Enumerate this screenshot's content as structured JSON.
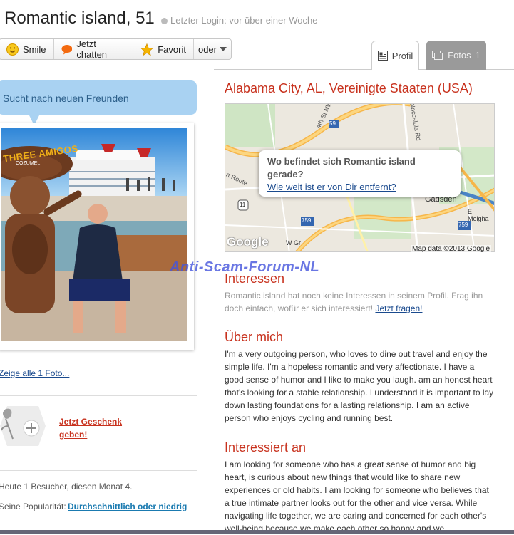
{
  "header": {
    "title": "Romantic island, 51",
    "status": "Letzter Login: vor über einer Woche"
  },
  "actions": {
    "smile": "Smile",
    "chat": "Jetzt chatten",
    "favorite": "Favorit",
    "more": "oder"
  },
  "tabs": {
    "profil": "Profil",
    "fotos": "Fotos",
    "fotos_count": "1"
  },
  "left": {
    "bubble": "Sucht nach neuen Freunden",
    "photo_sign_text": "THREE AMIGOS",
    "photo_sign_sub": "COZUMEL",
    "all_photos": "Zeige alle 1 Foto...",
    "gift_link": "Jetzt Geschenk geben!",
    "visitors": "Heute 1 Besucher, diesen Monat 4.",
    "popularity_label": "Seine Popularität:",
    "popularity_value": "Durchschnittlich oder niedrig"
  },
  "location": "Alabama City, AL, Vereinigte Staaten (USA)",
  "map": {
    "popup_question": "Wo befindet sich Romantic island gerade?",
    "popup_link": "Wie weit ist er von Dir entfernt?",
    "copyright": "Map data ©2013 Google",
    "logo": "Google",
    "labels": {
      "street1": "4th St NW",
      "street2": "Noccalula Rd",
      "route": "Route",
      "city": "Gadsden",
      "meigh": "E Meigha",
      "wg": "W Gr",
      "court": "rt Route"
    },
    "shields": [
      "59",
      "11",
      "759",
      "759"
    ]
  },
  "watermark": "Anti-Scam-Forum-NL",
  "sections": {
    "interests_title": "Interessen",
    "interests_text": "Romantic island hat noch keine Interessen in seinem Profil. Frag ihn doch einfach, wofür er sich interessiert!",
    "interests_link": "Jetzt fragen!",
    "about_title": "Über mich",
    "about_text": "I'm a very outgoing person, who loves to dine out travel and enjoy the simple life. I'm a hopeless romantic and very affectionate. I have a good sense of humor and I like to make you laugh. am an honest heart that's looking for a stable relationship. I understand it is important to lay down lasting foundations for a lasting relationship. I am an active person who enjoys cycling and running best.",
    "interested_title": "Interessiert an",
    "interested_text": "I am looking for someone who has a great sense of humor and big heart, is curious about new things that would like to share new experiences or old habits. I am looking for someone who believes that a true intimate partner looks out for the other and vice versa. While navigating life together, we are caring and concerned for each other's well-being because we make each other so happy and we"
  },
  "colors": {
    "accent": "#c8321e",
    "link": "#1a4a8e",
    "bubble": "#a9d2f2"
  }
}
